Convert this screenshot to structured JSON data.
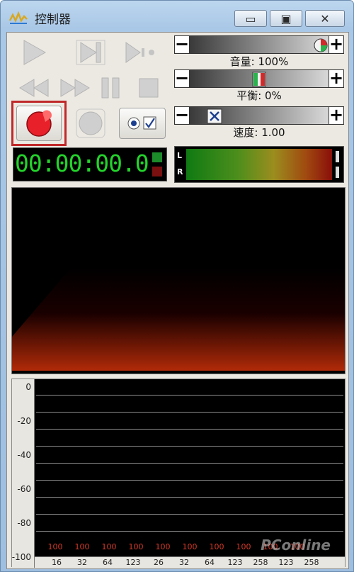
{
  "window": {
    "title": "控制器"
  },
  "title_buttons": {
    "minimize": "▭",
    "maximize": "▣",
    "close": "✕"
  },
  "sliders": {
    "volume": {
      "label": "音量: 100%",
      "minus": "−",
      "plus": "+",
      "value": 1.0
    },
    "balance": {
      "label": "平衡: 0%",
      "minus": "−",
      "plus": "+",
      "value": 0.5
    },
    "speed": {
      "label": "速度: 1.00",
      "minus": "−",
      "plus": "+",
      "value": 0.14
    }
  },
  "time_display": "00:00:00.0",
  "level_meter": {
    "left": "L",
    "right": "R"
  },
  "eq": {
    "y_labels": [
      "0",
      "-20",
      "-40",
      "-60",
      "-80",
      "-100"
    ],
    "band_values": [
      "100",
      "100",
      "100",
      "100",
      "100",
      "100",
      "100",
      "100",
      "100",
      "100"
    ],
    "band_freqs": [
      "16",
      "32",
      "64",
      "123",
      "26",
      "32",
      "64",
      "123",
      "258",
      "123",
      "258"
    ]
  },
  "watermark": "PConline",
  "colors": {
    "time_text": "#23d42b",
    "record": "#e8202a",
    "eq_value": "#d83a2a",
    "highlight": "#c0282a"
  },
  "icons": {
    "play": "play-icon",
    "next": "skip-next-icon",
    "step": "step-icon",
    "rewind": "rewind-icon",
    "forward": "fast-forward-icon",
    "pause": "pause-icon",
    "stop": "stop-icon",
    "record": "record-icon",
    "record_alt": "record-alt-icon",
    "options": "options-icon"
  }
}
